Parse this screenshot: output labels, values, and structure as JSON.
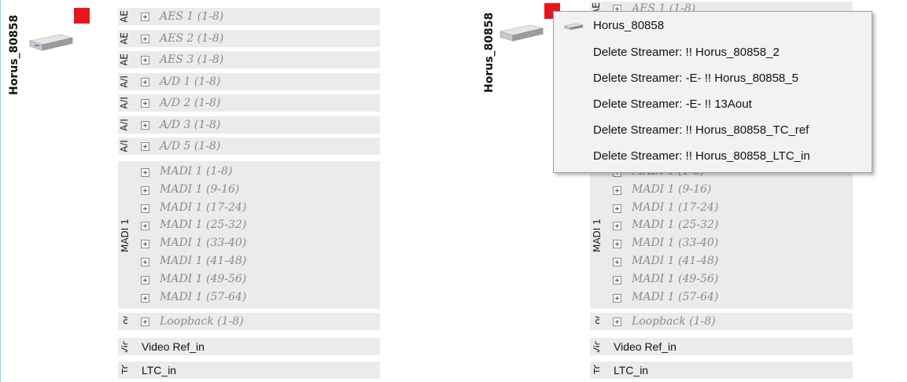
{
  "device": {
    "name": "Horus_80858"
  },
  "groups_left": [
    {
      "tag": "AE",
      "channels": [
        "AES 1 (1-8)"
      ]
    },
    {
      "tag": "AE",
      "channels": [
        "AES 2 (1-8)"
      ]
    },
    {
      "tag": "AE",
      "channels": [
        "AES 3 (1-8)"
      ]
    },
    {
      "tag": "A/I",
      "channels": [
        "A/D 1 (1-8)"
      ]
    },
    {
      "tag": "A/I",
      "channels": [
        "A/D 2 (1-8)"
      ]
    },
    {
      "tag": "A/I",
      "channels": [
        "A/D 3 (1-8)"
      ]
    },
    {
      "tag": "A/I",
      "channels": [
        "A/D 5 (1-8)"
      ]
    }
  ],
  "madi": {
    "label": "MADI 1",
    "channels": [
      "MADI 1 (1-8)",
      "MADI 1 (9-16)",
      "MADI 1 (17-24)",
      "MADI 1 (25-32)",
      "MADI 1 (33-40)",
      "MADI 1 (41-48)",
      "MADI 1 (49-56)",
      "MADI 1 (57-64)"
    ]
  },
  "loopback": {
    "tag": "Loc",
    "channel": "Loopback (1-8)"
  },
  "video": {
    "tag": "Vid",
    "channel": "Video Ref_in"
  },
  "ltc": {
    "tag": "LTC",
    "channel": "LTC_in"
  },
  "partial_top_right": "AES 1 (1-8)",
  "partial_top_tag": "AE",
  "context_menu": {
    "items": [
      "Horus_80858",
      "Delete Streamer: !! Horus_80858_2",
      "Delete Streamer: -E- !! Horus_80858_5",
      "Delete Streamer: -E- !! 13Aout",
      "Delete Streamer: !! Horus_80858_TC_ref",
      "Delete Streamer: !! Horus_80858_LTC_in"
    ]
  },
  "colors": {
    "status_red": "#e8161b",
    "row_bg": "#ebebeb",
    "channel_text": "#8a8a8a",
    "accent_line": "#8fd0e8"
  }
}
